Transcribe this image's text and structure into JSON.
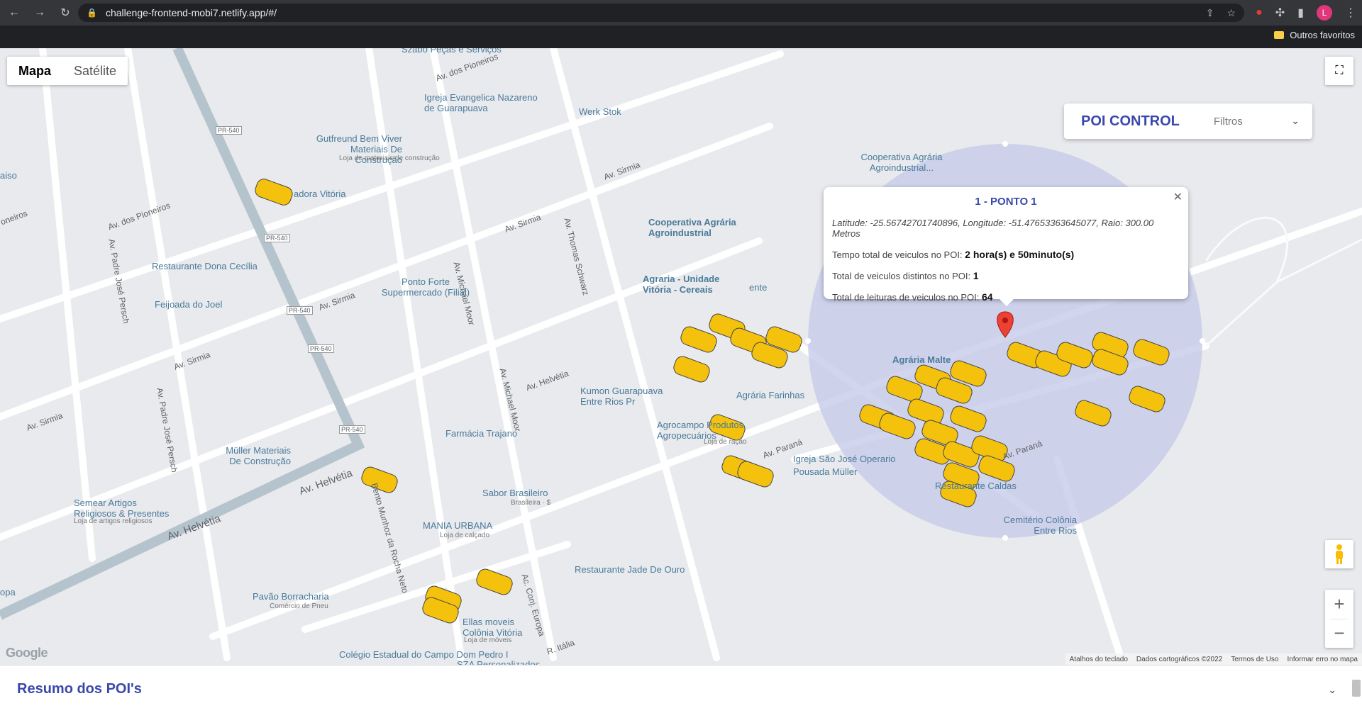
{
  "browser": {
    "url": "challenge-frontend-mobi7.netlify.app/#/",
    "bookmark_folder": "Outros favoritos",
    "avatar_initial": "L"
  },
  "map": {
    "type_buttons": [
      "Mapa",
      "Satélite"
    ],
    "active_type": "Mapa",
    "road_labels": [
      "Av. dos Pioneiros",
      "Av. Sirmia",
      "Av. Helvétia",
      "Av. Paraná",
      "Av. Thomas Schwarz",
      "Av. Michael Moor",
      "Av. Padre José Persch",
      "Bento Munhoz da Rocha Neto",
      "Ac. Conj. Europa",
      "R. Itália",
      "PR-540"
    ],
    "poi_labels": [
      "Szabo Peças e Serviços",
      "Igreja Evangelica Nazareno de Guarapuava",
      "Werk Stok",
      "Gutfreund Bem Viver Materiais De Construção",
      "Loja de materiais de construção",
      "adora Vitória",
      "Cooperativa Agrária Agroindustrial...",
      "Cooperativa Agrária Agroindustrial",
      "Restaurante Dona Cecília",
      "Ponto Forte Supermercado (Filial)",
      "Agraria - Unidade Vitória - Cereais",
      "Feijoada do Joel",
      "Agrária Malte",
      "Kumon Guarapuava Entre Rios Pr",
      "Agrária Farinhas",
      "Farmácia Trajano",
      "Agrocampo Produtos Agropecuários",
      "Loja de ração",
      "Igreja São José Operario",
      "Pousada Müller",
      "Müller Materiais De Construção",
      "Sabor Brasileiro",
      "Brasileira · $",
      "Restaurante Caldas",
      "Semear Artigos Religiosos & Presentes",
      "Loja de artigos religiosos",
      "MANIA URBANA",
      "Loja de calçado",
      "Cemitério Colônia Entre Rios",
      "Restaurante Jade De Ouro",
      "Pavão Borracharia",
      "Comércio de Pneu",
      "Ellas moveis Colônia Vitória",
      "Loja de móveis",
      "Colégio Estadual do Campo Dom Pedro I",
      "SZA Personalizados",
      "ente",
      "aiso",
      "oneiros",
      "opa"
    ],
    "google": "Google",
    "attribution": [
      "Atalhos do teclado",
      "Dados cartográficos ©2022",
      "Termos de Uso",
      "Informar erro no mapa"
    ]
  },
  "poi_control": {
    "title": "POI CONTROL",
    "filters": "Filtros"
  },
  "info_window": {
    "title": "1 - PONTO 1",
    "coords": "Latitude: -25.56742701740896, Longitude: -51.47653363645077, Raio: 300.00 Metros",
    "time_label": "Tempo total de veiculos no POI:",
    "time_value": "2 hora(s) e 50minuto(s)",
    "distinct_label": "Total de veiculos distintos no POI:",
    "distinct_value": "1",
    "reads_label": "Total de leituras de veiculos no POI:",
    "reads_value": "64"
  },
  "summary": {
    "title": "Resumo dos POI's"
  },
  "colors": {
    "accent": "#3949ab",
    "circle": "#c5cae9",
    "taxi": "#f4c20d",
    "marker": "#ea4335"
  }
}
